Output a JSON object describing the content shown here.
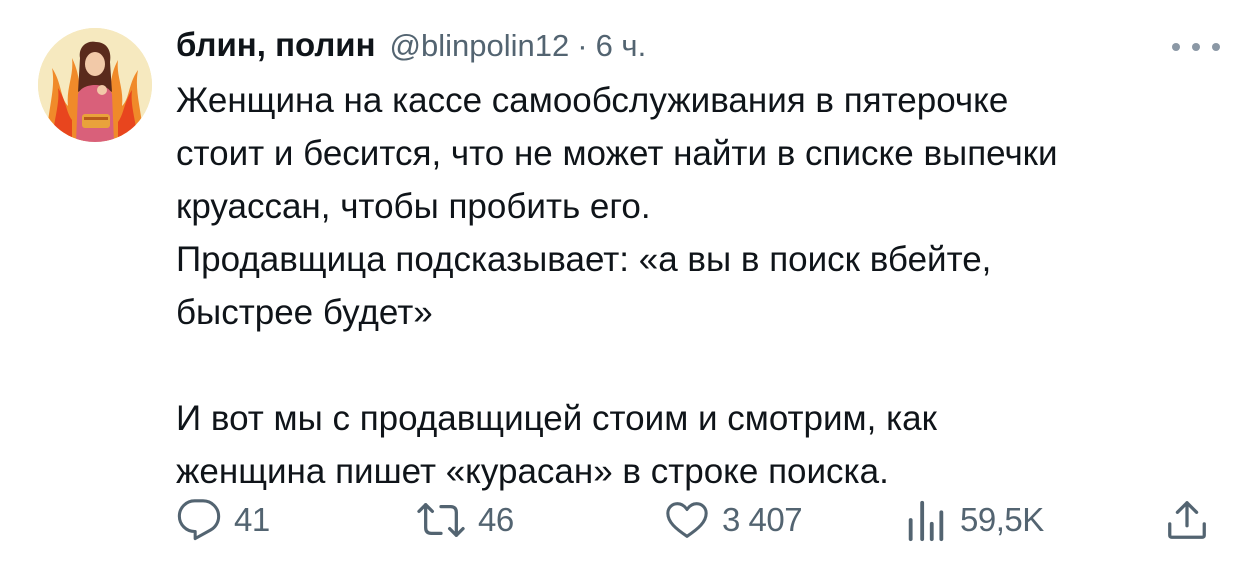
{
  "tweet": {
    "author_name": "блин, полин",
    "handle": "@blinpolin12",
    "separator": "·",
    "time": "6 ч.",
    "paragraph1": [
      "Женщина на кассе самообслуживания в пятерочке",
      "стоит и бесится, что не может найти в списке выпечки",
      "круассан, чтобы пробить его.",
      "Продавщица подсказывает: «а вы в поиск вбейте,",
      "быстрее будет»"
    ],
    "paragraph2": [
      "И вот мы с продавщицей стоим и смотрим, как",
      "женщина пишет «курасан» в строке поиска."
    ]
  },
  "actions": {
    "replies": "41",
    "retweets": "46",
    "likes": "3 407",
    "views": "59,5K"
  },
  "icons": {
    "more": "more-horizontal-icon",
    "reply": "reply-icon",
    "retweet": "retweet-icon",
    "like": "heart-icon",
    "views": "views-chart-icon",
    "share": "share-icon"
  },
  "colors": {
    "text": "#0f1419",
    "secondary": "#536471"
  }
}
